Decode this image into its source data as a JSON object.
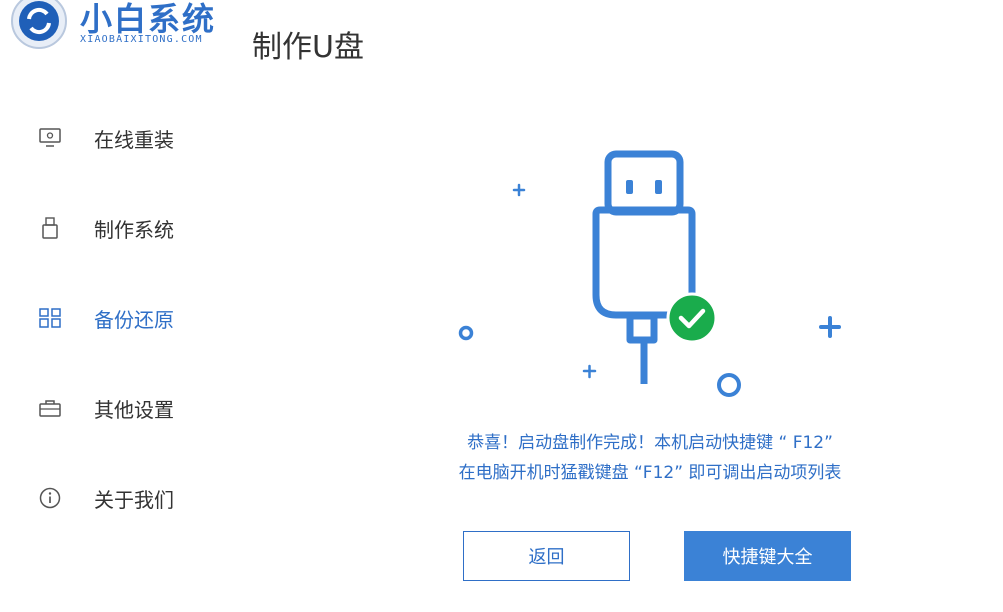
{
  "brand": {
    "name": "小白系统",
    "domain": "XIAOBAIXITONG.COM"
  },
  "page": {
    "title": "制作U盘"
  },
  "sidebar": {
    "items": [
      {
        "label": "在线重装",
        "icon": "monitor-icon",
        "active": false
      },
      {
        "label": "制作系统",
        "icon": "usb-drive-icon",
        "active": false
      },
      {
        "label": "备份还原",
        "icon": "grid-icon",
        "active": true
      },
      {
        "label": "其他设置",
        "icon": "briefcase-icon",
        "active": false
      },
      {
        "label": "关于我们",
        "icon": "info-icon",
        "active": false
      }
    ]
  },
  "message": {
    "line1": "恭喜！启动盘制作完成！本机启动快捷键 “ F12”",
    "line2": "在电脑开机时猛戳键盘 “F12” 即可调出启动项列表"
  },
  "buttons": {
    "back": "返回",
    "hotkeys": "快捷键大全"
  },
  "colors": {
    "accent": "#2f6fc7",
    "success": "#1aac4c",
    "button_fill": "#3b82d6"
  }
}
